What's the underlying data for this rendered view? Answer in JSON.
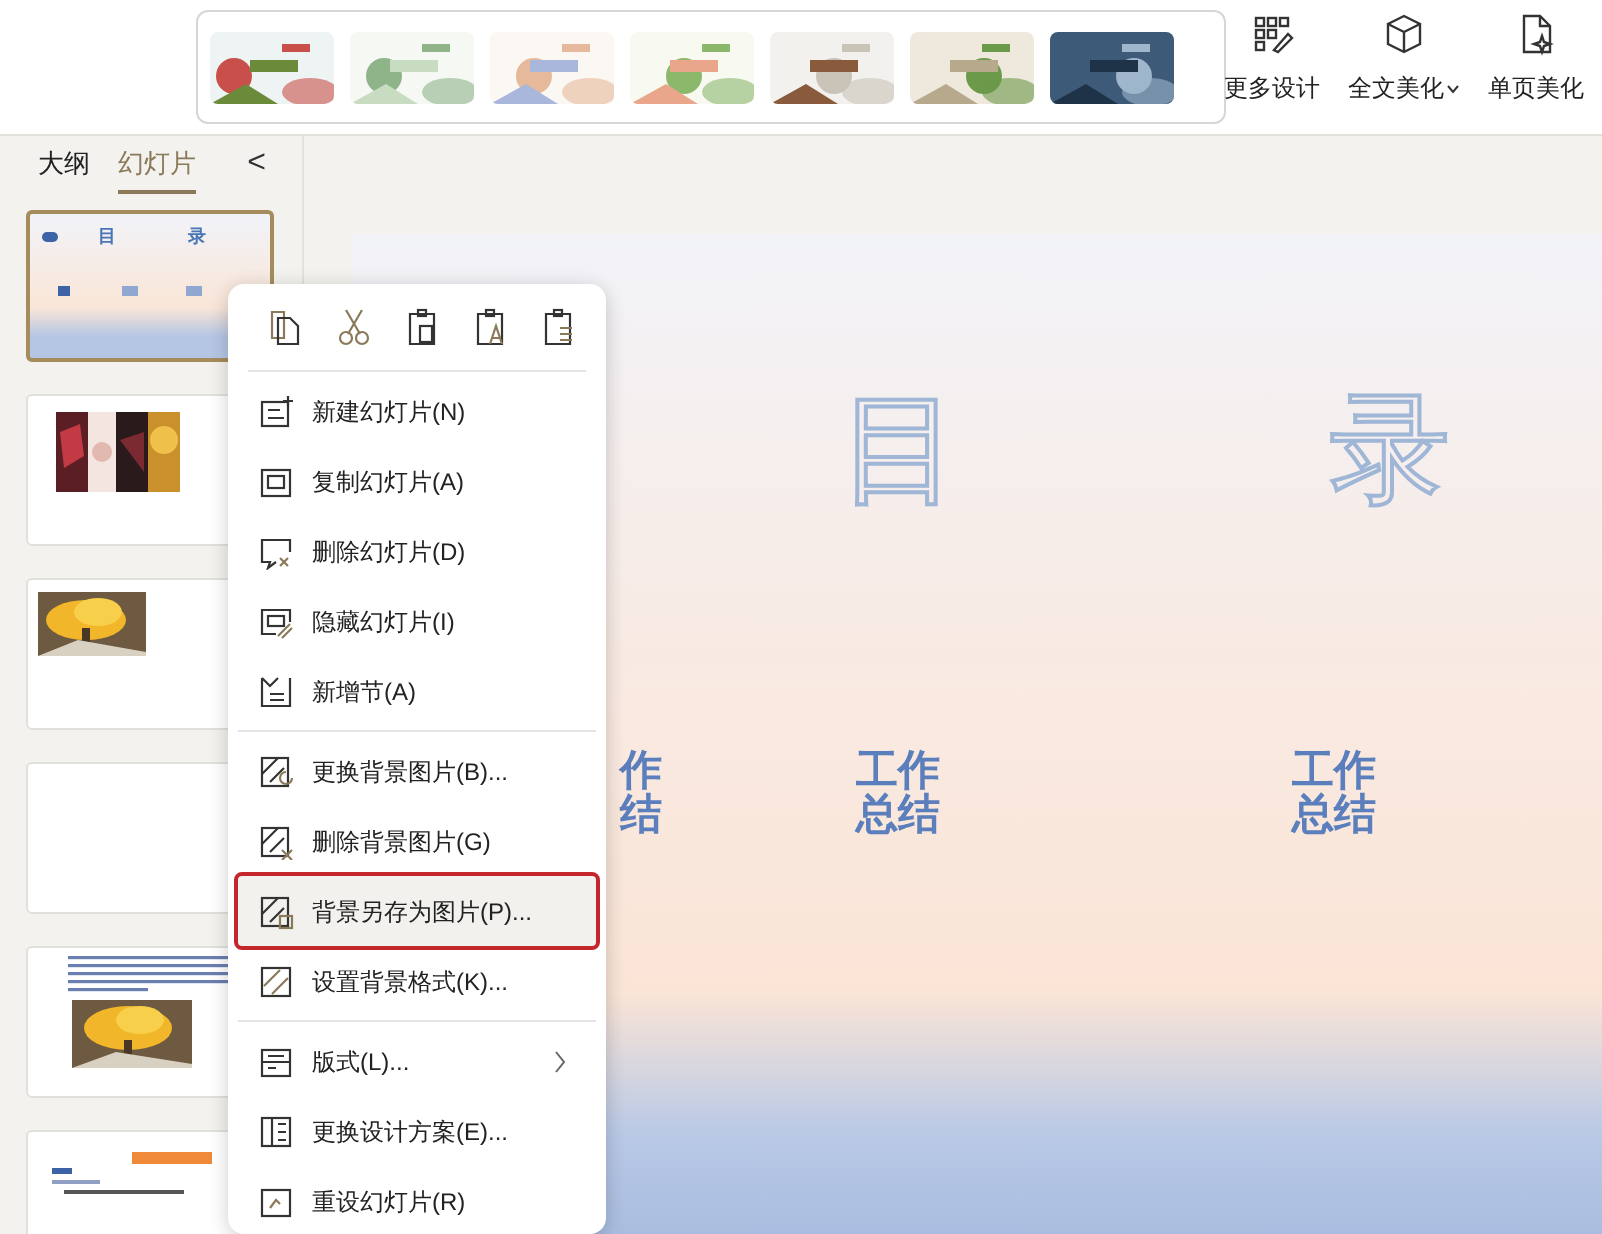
{
  "templates": [
    {
      "kind": "picture"
    },
    {
      "kind": "picture"
    },
    {
      "kind": "picture"
    },
    {
      "kind": "picture"
    },
    {
      "kind": "picture"
    },
    {
      "kind": "picture"
    },
    {
      "kind": "picture"
    }
  ],
  "toolbar": [
    {
      "label": "更多设计",
      "caret": false
    },
    {
      "label": "全文美化",
      "caret": true
    },
    {
      "label": "单页美化",
      "caret": false
    }
  ],
  "panel_tabs": [
    {
      "label": "大纲",
      "selected": false
    },
    {
      "label": "幻灯片",
      "selected": true
    }
  ],
  "collapse": "<",
  "slides": [
    {
      "kind": "toc",
      "selected": true,
      "texts": [
        "目",
        "录"
      ]
    },
    {
      "kind": "pictures",
      "selected": false
    },
    {
      "kind": "picture",
      "selected": false
    },
    {
      "kind": "blank",
      "selected": false
    },
    {
      "kind": "text-picture",
      "selected": false
    },
    {
      "kind": "heading",
      "selected": false
    }
  ],
  "slide": {
    "title": [
      "目",
      "录"
    ],
    "labels": [
      "作结",
      "工作总结",
      "工作总结"
    ]
  },
  "context_menu": {
    "sections": [
      [
        {
          "label": "新建幻灯片(N)",
          "selected": false,
          "submenu": false
        },
        {
          "label": "复制幻灯片(A)",
          "selected": false,
          "submenu": false
        },
        {
          "label": "删除幻灯片(D)",
          "selected": false,
          "submenu": false
        },
        {
          "label": "隐藏幻灯片(I)",
          "selected": false,
          "submenu": false
        },
        {
          "label": "新增节(A)",
          "selected": false,
          "submenu": false
        }
      ],
      [
        {
          "label": "更换背景图片(B)...",
          "selected": false,
          "submenu": false
        },
        {
          "label": "删除背景图片(G)",
          "selected": false,
          "submenu": false
        },
        {
          "label": "背景另存为图片(P)...",
          "selected": true,
          "submenu": false
        },
        {
          "label": "设置背景格式(K)...",
          "selected": false,
          "submenu": false
        }
      ],
      [
        {
          "label": "版式(L)...",
          "selected": false,
          "submenu": true
        },
        {
          "label": "更换设计方案(E)...",
          "selected": false,
          "submenu": false
        },
        {
          "label": "重设幻灯片(R)",
          "selected": false,
          "submenu": false
        }
      ]
    ]
  }
}
